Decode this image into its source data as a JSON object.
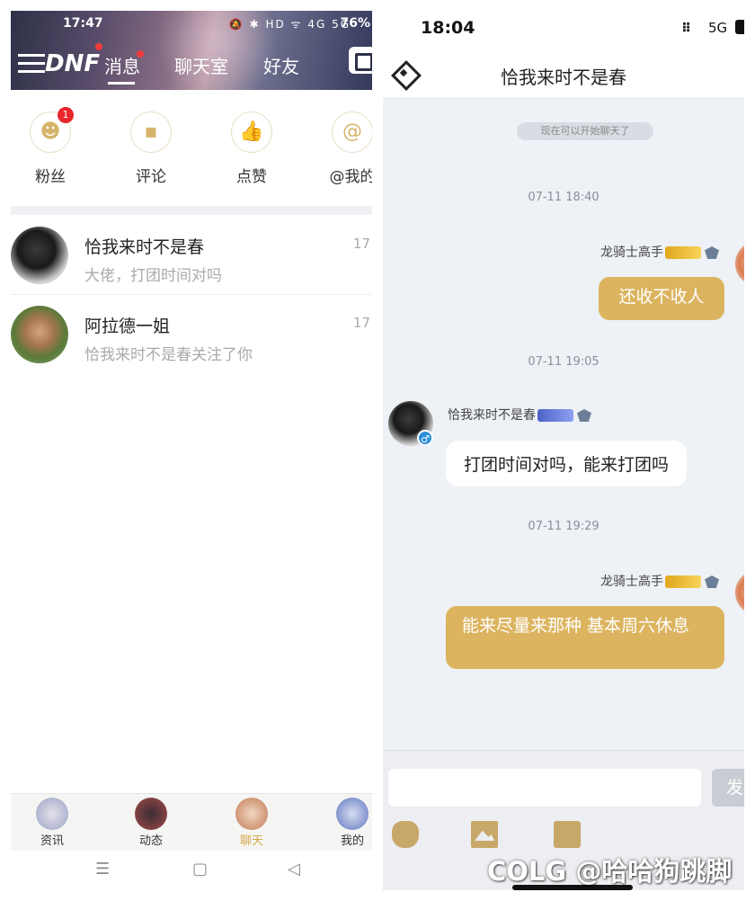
{
  "left": {
    "status": {
      "time": "17:47",
      "icons": "🔕 ✱ HD ᯤ 4G 5G",
      "battery": "76%"
    },
    "logo": "DNF",
    "tabs": [
      {
        "label": "消息"
      },
      {
        "label": "聊天室"
      },
      {
        "label": "好友"
      }
    ],
    "quick_actions": [
      {
        "label": "粉丝",
        "badge": "1",
        "icon": "fans-icon"
      },
      {
        "label": "评论",
        "icon": "comment-icon"
      },
      {
        "label": "点赞",
        "icon": "like-icon"
      },
      {
        "label": "@我的",
        "icon": "at-icon"
      }
    ],
    "conversations": [
      {
        "name": "恰我来时不是春",
        "preview": "大佬，打团时间对吗",
        "time": "17"
      },
      {
        "name": "阿拉德一姐",
        "preview": "恰我来时不是春关注了你",
        "time": "17"
      }
    ],
    "bottom_nav": [
      {
        "label": "资讯"
      },
      {
        "label": "动态"
      },
      {
        "label": "聊天",
        "active": true
      },
      {
        "label": "我的"
      }
    ],
    "system_nav": {
      "menu": "☰",
      "home": "▢",
      "back": "◁"
    }
  },
  "right": {
    "status": {
      "time": "18:04",
      "signal": "⠿",
      "network": "5G"
    },
    "title": "恰我来时不是春",
    "system_notice": "现在可以开始聊天了",
    "messages": [
      {
        "time": "07-11 18:40",
        "sender": "龙骑士高手",
        "text": "还收不收人",
        "mine": true
      },
      {
        "time": "07-11 19:05",
        "sender": "恰我来时不是春",
        "text": "打团时间对吗，能来打团吗",
        "mine": false
      },
      {
        "time": "07-11 19:29",
        "sender": "龙骑士高手",
        "text": "能来尽量来那种   基本周六休息",
        "mine": true
      }
    ],
    "send_label": "发",
    "male_symbol": "♂"
  },
  "watermark": "COLG @哈哈狗跳脚",
  "colors": {
    "gold": "#dcb45f",
    "chat_bg": "#eef1f5",
    "badge_red": "#e8262c",
    "active_nav": "#d4a84d"
  }
}
